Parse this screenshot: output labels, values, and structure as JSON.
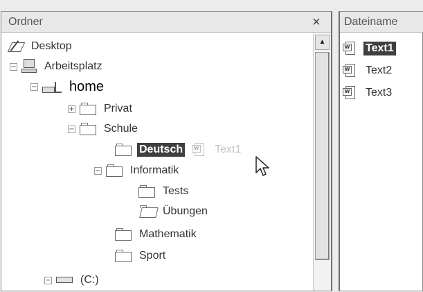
{
  "folder_panel": {
    "title": "Ordner",
    "close_label": "×",
    "tree": {
      "desktop": "Desktop",
      "arbeitsplatz": "Arbeitsplatz",
      "home": "home",
      "privat": "Privat",
      "schule": "Schule",
      "deutsch": "Deutsch",
      "drag_ghost": "Text1",
      "informatik": "Informatik",
      "tests": "Tests",
      "uebungen": "Übungen",
      "mathematik": "Mathematik",
      "sport": "Sport",
      "drive_c": "(C:)"
    },
    "expand_plus": "+",
    "collapse_minus": "−",
    "scroll_up_glyph": "▲"
  },
  "file_panel": {
    "column_header": "Dateiname",
    "files": [
      "Text1",
      "Text2",
      "Text3"
    ],
    "doc_glyph": "W"
  }
}
